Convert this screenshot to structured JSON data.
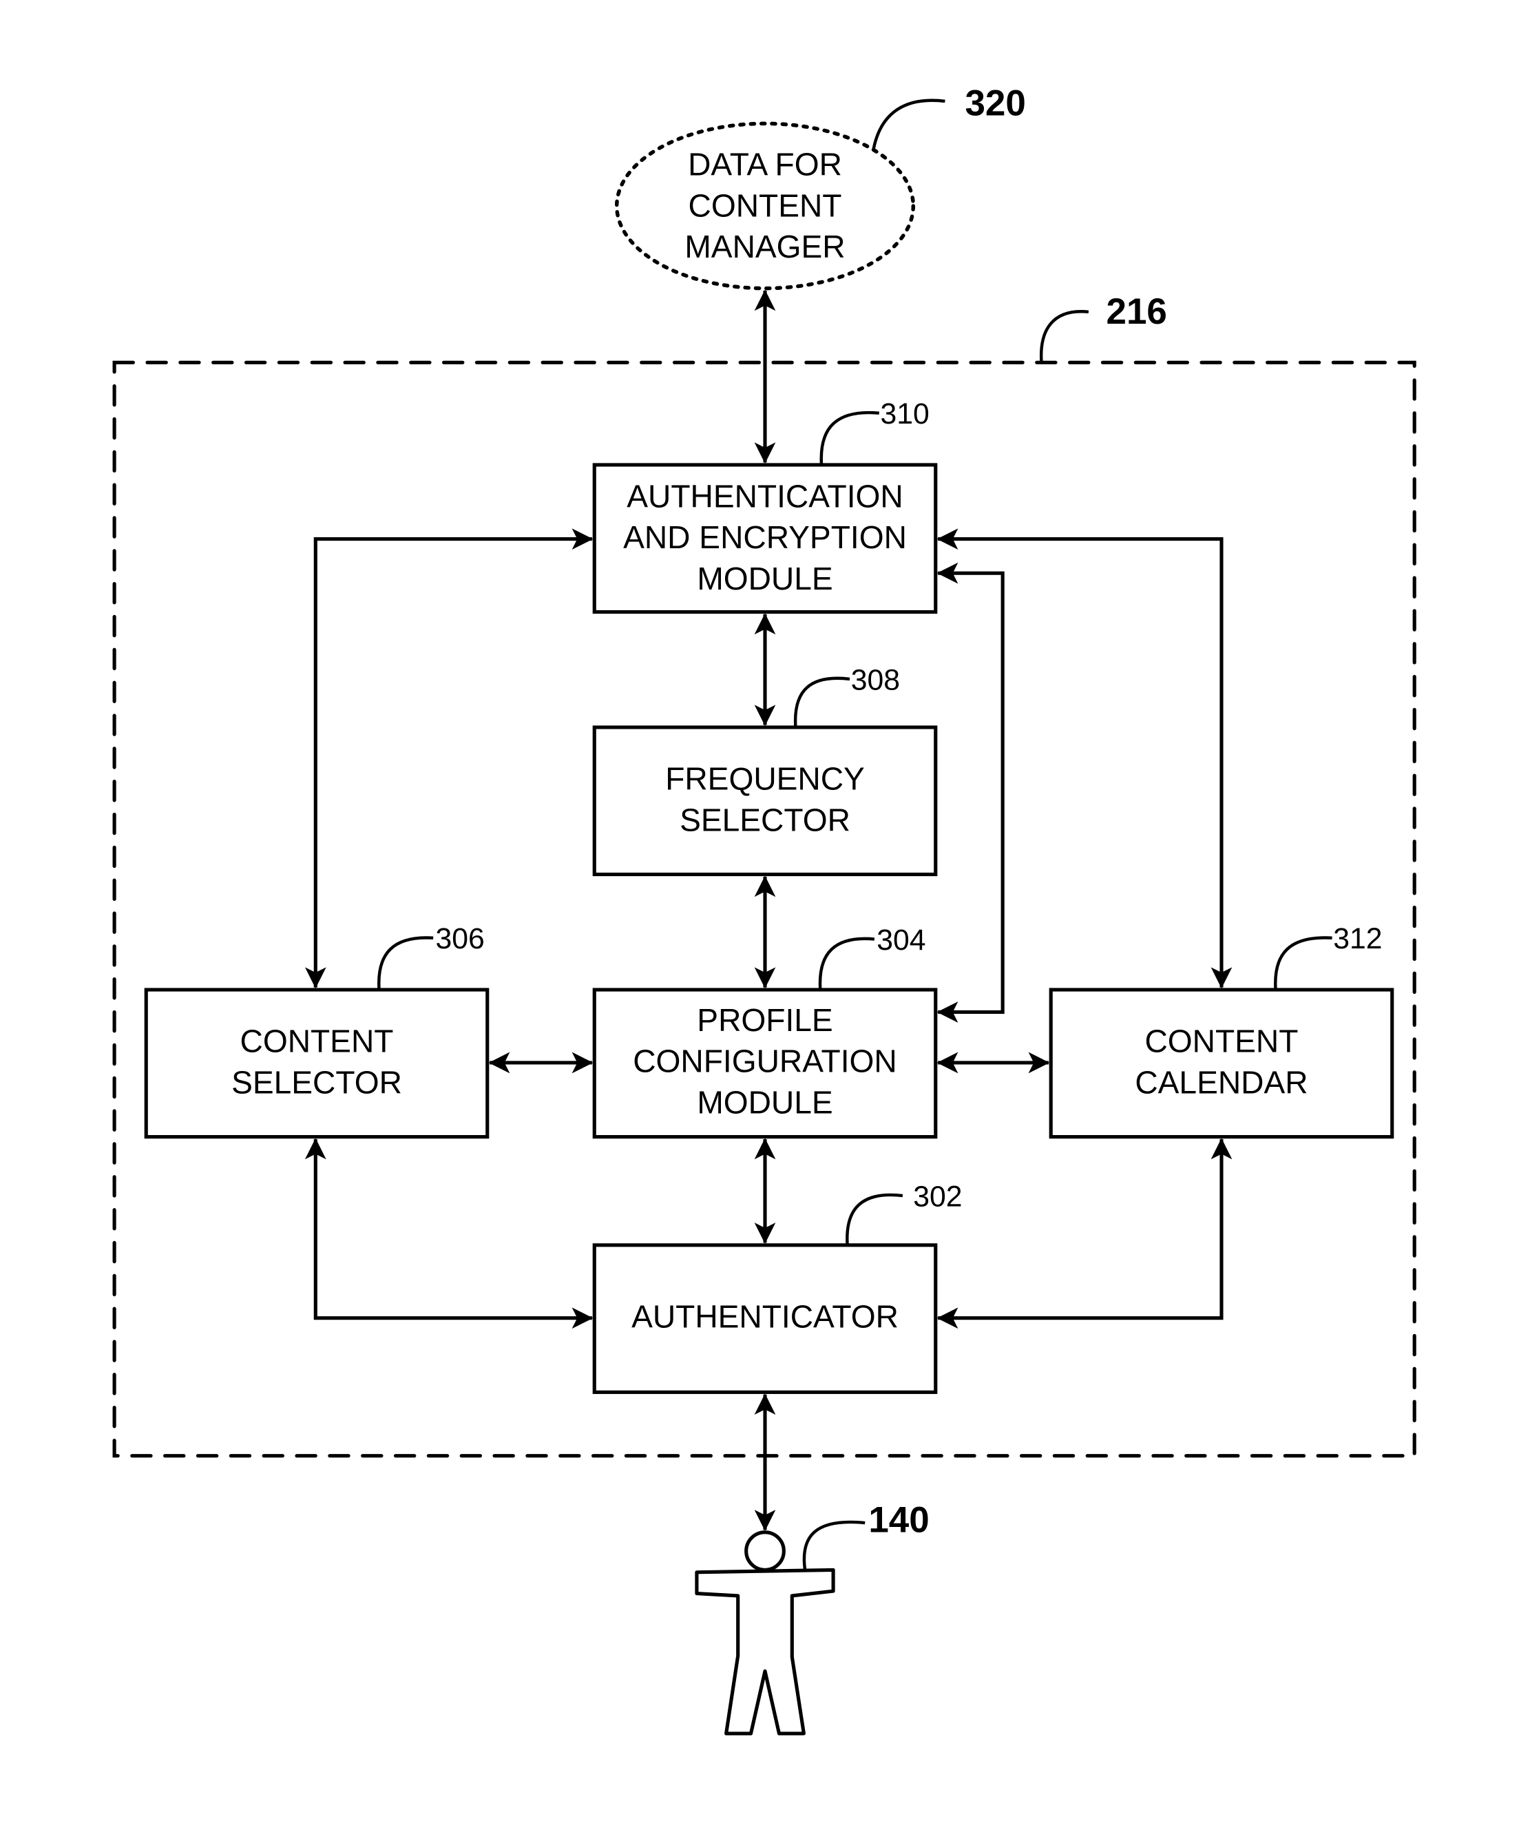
{
  "figure": {
    "external_data": {
      "lines": [
        "DATA FOR",
        "CONTENT",
        "MANAGER"
      ],
      "ref": "320"
    },
    "container": {
      "ref": "216"
    },
    "modules": {
      "auth_encryption": {
        "lines": [
          "AUTHENTICATION",
          "AND ENCRYPTION",
          "MODULE"
        ],
        "ref": "310"
      },
      "frequency_selector": {
        "lines": [
          "FREQUENCY",
          "SELECTOR"
        ],
        "ref": "308"
      },
      "profile_configuration": {
        "lines": [
          "PROFILE",
          "CONFIGURATION",
          "MODULE"
        ],
        "ref": "304"
      },
      "content_selector": {
        "lines": [
          "CONTENT",
          "SELECTOR"
        ],
        "ref": "306"
      },
      "content_calendar": {
        "lines": [
          "CONTENT",
          "CALENDAR"
        ],
        "ref": "312"
      },
      "authenticator": {
        "lines": [
          "AUTHENTICATOR"
        ],
        "ref": "302"
      }
    },
    "user": {
      "ref": "140",
      "icon": "person-icon"
    },
    "connections": [
      {
        "from": "external_data",
        "to": "auth_encryption",
        "direction": "bidirectional"
      },
      {
        "from": "auth_encryption",
        "to": "frequency_selector",
        "direction": "bidirectional"
      },
      {
        "from": "frequency_selector",
        "to": "profile_configuration",
        "direction": "bidirectional"
      },
      {
        "from": "profile_configuration",
        "to": "authenticator",
        "direction": "bidirectional"
      },
      {
        "from": "content_selector",
        "to": "profile_configuration",
        "direction": "bidirectional"
      },
      {
        "from": "profile_configuration",
        "to": "content_calendar",
        "direction": "bidirectional"
      },
      {
        "from": "auth_encryption",
        "to": "content_selector",
        "direction": "bidirectional"
      },
      {
        "from": "auth_encryption",
        "to": "content_calendar",
        "direction": "bidirectional"
      },
      {
        "from": "auth_encryption",
        "to": "profile_configuration",
        "direction": "bidirectional"
      },
      {
        "from": "content_selector",
        "to": "authenticator",
        "direction": "bidirectional"
      },
      {
        "from": "content_calendar",
        "to": "authenticator",
        "direction": "bidirectional"
      },
      {
        "from": "authenticator",
        "to": "user",
        "direction": "bidirectional"
      }
    ]
  }
}
